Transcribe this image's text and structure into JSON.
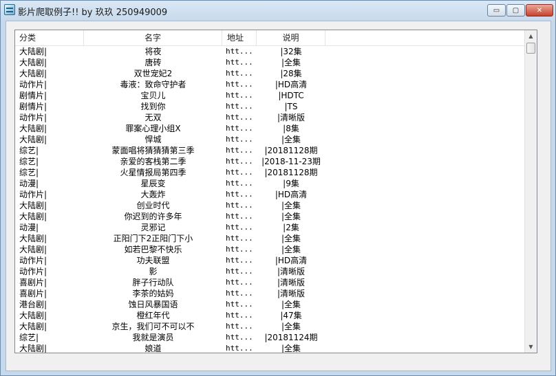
{
  "window": {
    "title": "影片爬取例子!! by 玖玖 250949009"
  },
  "caption_buttons": {
    "minimize": "▭",
    "maximize": "▢",
    "close": "✕"
  },
  "list": {
    "headers": {
      "category": "分类",
      "name": "名字",
      "address": "地址",
      "description": "说明"
    },
    "rows": [
      {
        "category": "大陆剧|",
        "name": "将夜",
        "address": "htt...",
        "description": "|32集"
      },
      {
        "category": "大陆剧|",
        "name": "唐砖",
        "address": "htt...",
        "description": "|全集"
      },
      {
        "category": "大陆剧|",
        "name": "双世宠妃2",
        "address": "htt...",
        "description": "|28集"
      },
      {
        "category": "动作片|",
        "name": "毒液：致命守护者",
        "address": "htt...",
        "description": "|HD高清"
      },
      {
        "category": "剧情片|",
        "name": "宝贝儿",
        "address": "htt...",
        "description": "|HDTC"
      },
      {
        "category": "剧情片|",
        "name": "找到你",
        "address": "htt...",
        "description": "|TS"
      },
      {
        "category": "动作片|",
        "name": "无双",
        "address": "htt...",
        "description": "|清晰版"
      },
      {
        "category": "大陆剧|",
        "name": "罪案心理小组X",
        "address": "htt...",
        "description": "|8集"
      },
      {
        "category": "大陆剧|",
        "name": "悍城",
        "address": "htt...",
        "description": "|全集"
      },
      {
        "category": "综艺|",
        "name": "蒙面唱将猜猜猜第三季",
        "address": "htt...",
        "description": "|20181128期"
      },
      {
        "category": "综艺|",
        "name": "亲爱的客栈第二季",
        "address": "htt...",
        "description": "|2018-11-23期"
      },
      {
        "category": "综艺|",
        "name": "火星情报局第四季",
        "address": "htt...",
        "description": "|20181128期"
      },
      {
        "category": "动漫|",
        "name": "星辰变",
        "address": "htt...",
        "description": "|9集"
      },
      {
        "category": "动作片|",
        "name": "大轰炸",
        "address": "htt...",
        "description": "|HD高清"
      },
      {
        "category": "大陆剧|",
        "name": "创业时代",
        "address": "htt...",
        "description": "|全集"
      },
      {
        "category": "大陆剧|",
        "name": "你迟到的许多年",
        "address": "htt...",
        "description": "|全集"
      },
      {
        "category": "动漫|",
        "name": "灵邪记",
        "address": "htt...",
        "description": "|2集"
      },
      {
        "category": "大陆剧|",
        "name": "正阳门下2正阳门下小",
        "address": "htt...",
        "description": "|全集"
      },
      {
        "category": "大陆剧|",
        "name": "如若巴黎不快乐",
        "address": "htt...",
        "description": "|全集"
      },
      {
        "category": "动作片|",
        "name": "功夫联盟",
        "address": "htt...",
        "description": "|HD高清"
      },
      {
        "category": "动作片|",
        "name": "影",
        "address": "htt...",
        "description": "|清晰版"
      },
      {
        "category": "喜剧片|",
        "name": "胖子行动队",
        "address": "htt...",
        "description": "|清晰版"
      },
      {
        "category": "喜剧片|",
        "name": "李茶的姑妈",
        "address": "htt...",
        "description": "|清晰版"
      },
      {
        "category": "港台剧|",
        "name": "蚀日风暴国语",
        "address": "htt...",
        "description": "|全集"
      },
      {
        "category": "大陆剧|",
        "name": "橙红年代",
        "address": "htt...",
        "description": "|47集"
      },
      {
        "category": "大陆剧|",
        "name": "京生，我们可不可以不",
        "address": "htt...",
        "description": "|全集"
      },
      {
        "category": "综艺|",
        "name": "我就是演员",
        "address": "htt...",
        "description": "|20181124期"
      },
      {
        "category": "大陆剧|",
        "name": "娘道",
        "address": "htt...",
        "description": "|全集"
      }
    ]
  },
  "scrollbar": {
    "up_glyph": "▲",
    "down_glyph": "▼"
  }
}
